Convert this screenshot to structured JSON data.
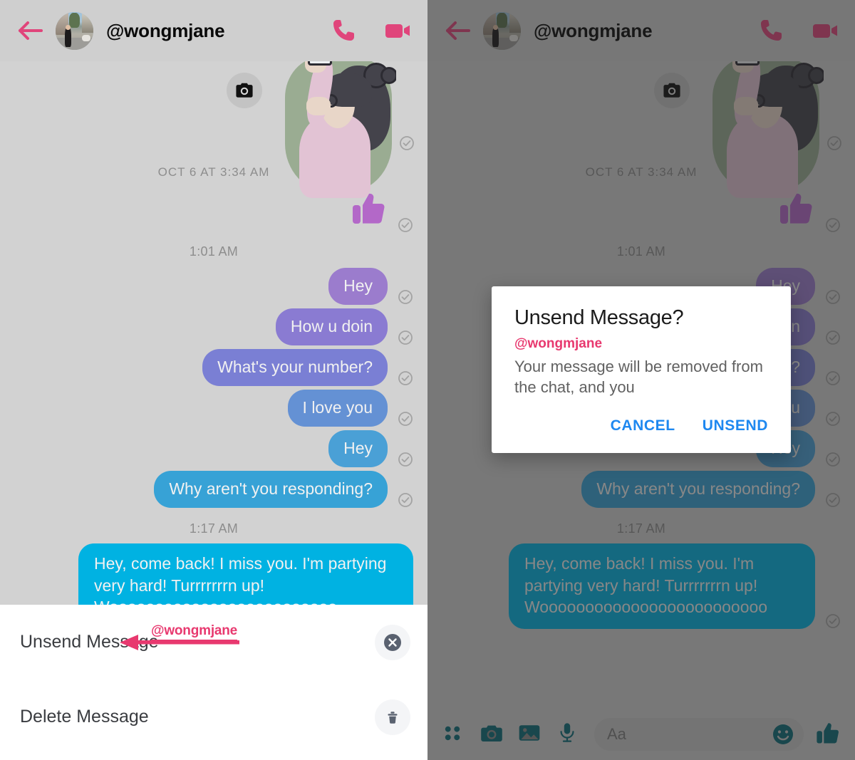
{
  "header": {
    "username": "@wongmjane",
    "back_icon": "back-arrow-icon",
    "avatar_icon": "avatar",
    "call_icon": "phone-icon",
    "video_icon": "video-camera-icon",
    "accent_color": "#e0457b",
    "background": "#cfcfcf"
  },
  "thread": {
    "background": "#d2d2d2",
    "camera_icon": "camera-icon",
    "sticker_icon": "sticker-image",
    "timestamps": {
      "first": "OCT 6 AT 3:34 AM",
      "second": "1:01 AM",
      "third": "1:17 AM"
    },
    "thumbs_up_reaction": "thumbs-up-icon",
    "delivery_icon": "delivered-check-icon",
    "messages": [
      {
        "text": "Hey",
        "color": "#9b7ccd"
      },
      {
        "text": "How u doin",
        "color": "#8a7bd2"
      },
      {
        "text": "What's your number?",
        "color": "#7a7fd4"
      },
      {
        "text": "I love you",
        "color": "#6491d4"
      },
      {
        "text": "Hey",
        "color": "#4aa0d6"
      },
      {
        "text": "Why aren't you responding?",
        "color": "#37a2d6"
      }
    ],
    "last_message": {
      "text": "Hey, come back! I miss you. I'm partying very hard! Turrrrrrrn up! Wooooooooooooooooooooooooo",
      "color": "#00b2e2"
    }
  },
  "sheet": {
    "items": [
      {
        "label": "Unsend Message",
        "icon": "close-circle-icon"
      },
      {
        "label": "Delete Message",
        "icon": "trash-icon"
      }
    ],
    "annotation": {
      "text": "@wongmjane",
      "icon": "annotation-arrow-icon",
      "color": "#e8396f"
    }
  },
  "dialog": {
    "title": "Unsend Message?",
    "watermark": "@wongmjane",
    "body": "Your message will be removed from the chat, and you",
    "cancel_label": "CANCEL",
    "confirm_label": "UNSEND",
    "button_color": "#1e88f0"
  },
  "composer": {
    "placeholder": "Aa",
    "icons": [
      "apps-grid-icon",
      "camera-icon",
      "photo-gallery-icon",
      "microphone-icon"
    ],
    "emoji_icon": "smiley-icon",
    "like_icon": "thumbs-up-icon",
    "accent_color": "#0b6b78"
  }
}
